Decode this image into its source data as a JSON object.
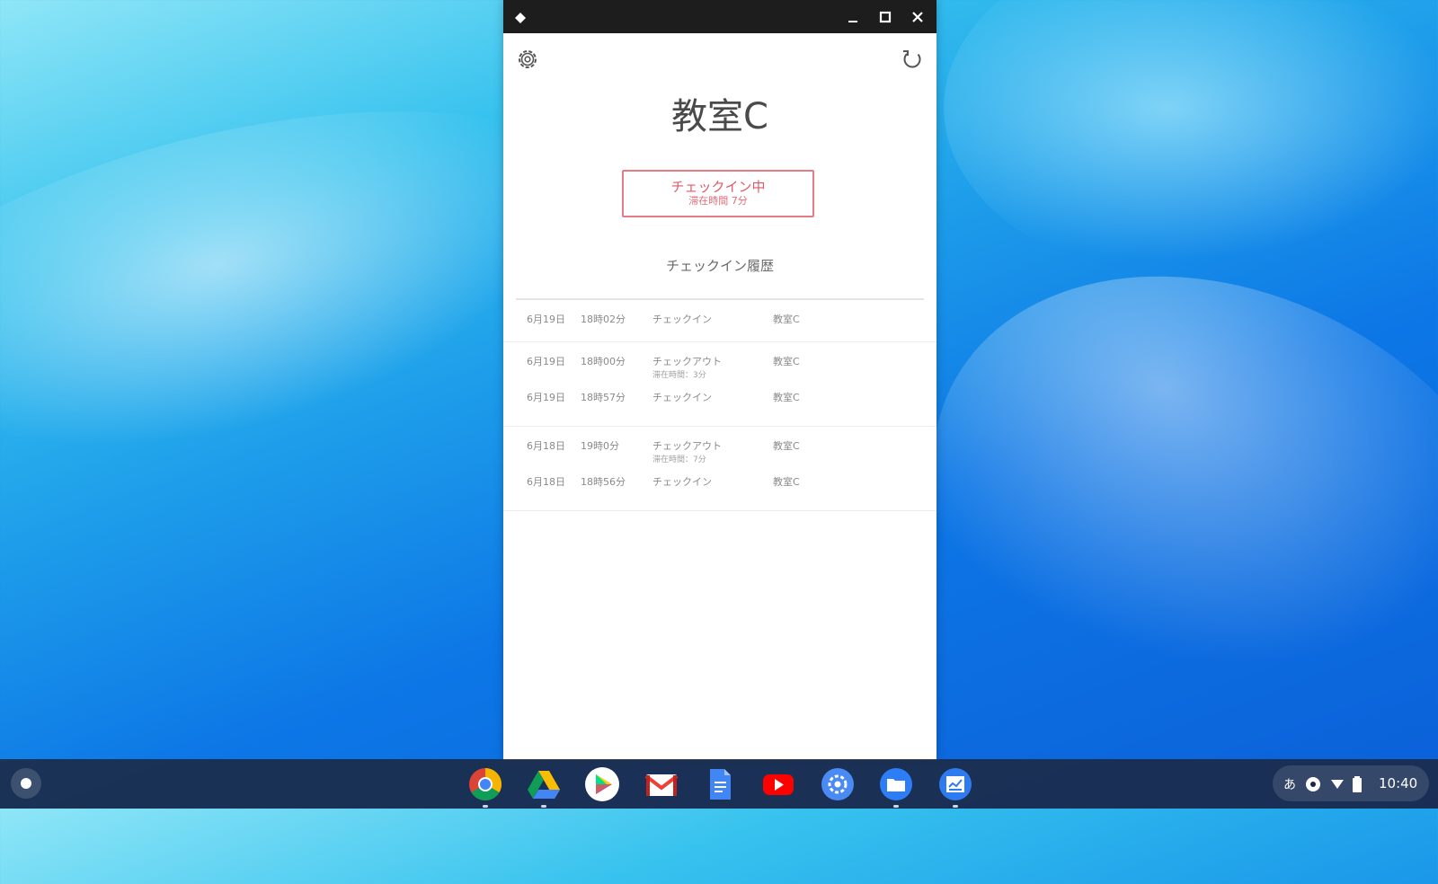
{
  "window": {
    "controls": {
      "minimize": "minimize-icon",
      "maximize": "maximize-icon",
      "close": "close-icon"
    }
  },
  "app": {
    "room_title": "教室C",
    "status": {
      "main": "チェックイン中",
      "sub": "滞在時間 7分"
    },
    "history_title": "チェックイン履歴",
    "history": [
      {
        "entries": [
          {
            "date": "6月19日",
            "time": "18時02分",
            "action": "チェックイン",
            "room": "教室C",
            "sub": ""
          }
        ]
      },
      {
        "entries": [
          {
            "date": "6月19日",
            "time": "18時00分",
            "action": "チェックアウト",
            "room": "教室C",
            "sub": "滞在時間：3分"
          },
          {
            "date": "6月19日",
            "time": "18時57分",
            "action": "チェックイン",
            "room": "教室C",
            "sub": ""
          }
        ]
      },
      {
        "entries": [
          {
            "date": "6月18日",
            "time": "19時0分",
            "action": "チェックアウト",
            "room": "教室C",
            "sub": "滞在時間：7分"
          },
          {
            "date": "6月18日",
            "time": "18時56分",
            "action": "チェックイン",
            "room": "教室C",
            "sub": ""
          }
        ]
      }
    ]
  },
  "shelf": {
    "apps": [
      "chrome-icon",
      "drive-icon",
      "play-store-icon",
      "gmail-icon",
      "docs-icon",
      "youtube-icon",
      "settings-icon",
      "files-icon",
      "checkin-app-icon"
    ],
    "tray": {
      "ime": "あ",
      "time": "10:40"
    }
  },
  "colors": {
    "accent": "#e05a69",
    "titlebar": "#1d1d1d",
    "shelf": "#1c2842"
  }
}
